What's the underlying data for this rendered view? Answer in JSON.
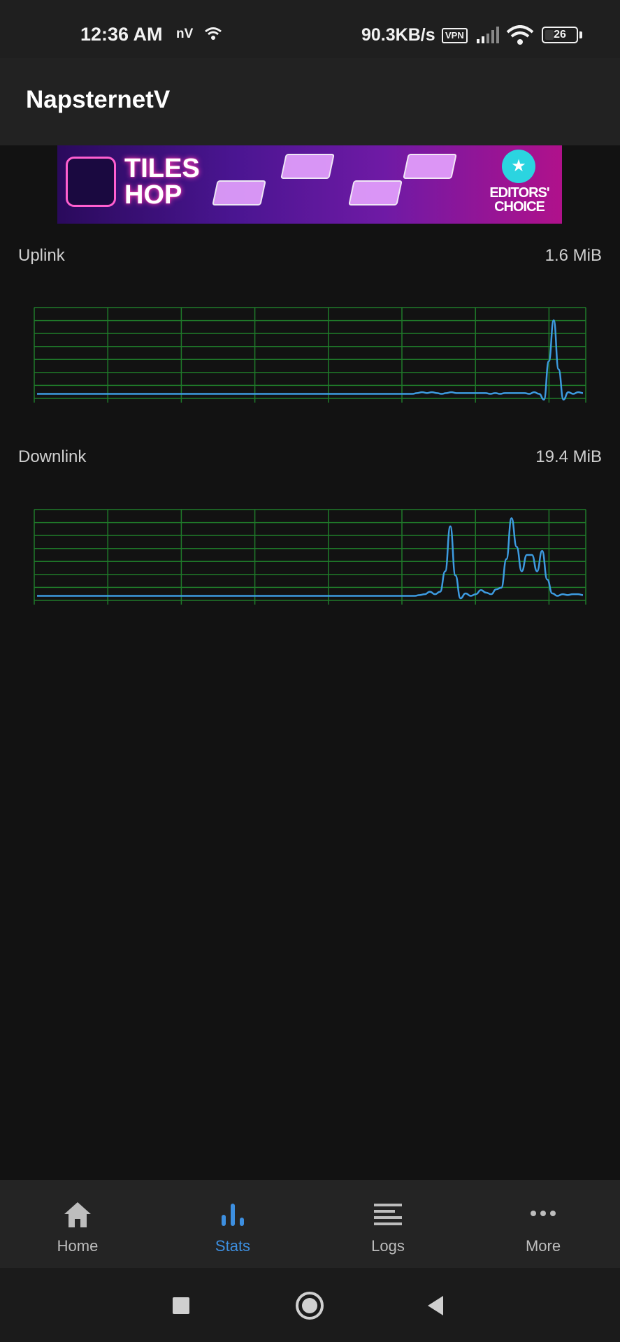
{
  "status_bar": {
    "time": "12:36 AM",
    "carrier_tag": "nV",
    "network_speed": "90.3KB/s",
    "vpn_label": "VPN",
    "battery_level": "26"
  },
  "app_bar": {
    "title": "NapsternetV"
  },
  "ad": {
    "title_line1": "TILES",
    "title_line2": "HOP",
    "badge_line1": "EDITORS'",
    "badge_line2": "CHOICE"
  },
  "uplink": {
    "label": "Uplink",
    "value": "1.6 MiB"
  },
  "downlink": {
    "label": "Downlink",
    "value": "19.4 MiB"
  },
  "chart_data": [
    {
      "type": "line",
      "title": "",
      "grid": true,
      "ylim": [
        0,
        1
      ],
      "series": [
        {
          "values": [
            0,
            0,
            0,
            0,
            0,
            0,
            0,
            0,
            0,
            0,
            0,
            0,
            0,
            0,
            0,
            0,
            0,
            0,
            0,
            0,
            0,
            0,
            0,
            0,
            0,
            0,
            0,
            0,
            0,
            0,
            0,
            0,
            0,
            0,
            0,
            0,
            0,
            0,
            0,
            0,
            0,
            0,
            0,
            0,
            0,
            0,
            0,
            0,
            0,
            0,
            0,
            0,
            0,
            0,
            0,
            0,
            0,
            0,
            0,
            0,
            0,
            0,
            0,
            0,
            0,
            0,
            0,
            0,
            0,
            0,
            0,
            0,
            0,
            0,
            0,
            0,
            0,
            0,
            0.01,
            0.02,
            0.01,
            0.02,
            0.01,
            0,
            0.01,
            0.02,
            0.01,
            0.01,
            0.01,
            0.01,
            0.01,
            0.01,
            0.01,
            0,
            0.01,
            0,
            0.01,
            0.01,
            0.01,
            0.01,
            0.01,
            0,
            0.02,
            0,
            -0.07,
            0.4,
            0.9,
            0.3,
            -0.07,
            0.02,
            0,
            0.02,
            0.01
          ]
        }
      ]
    },
    {
      "type": "line",
      "title": "",
      "grid": true,
      "ylim": [
        0,
        1
      ],
      "series": [
        {
          "values": [
            0,
            0,
            0,
            0,
            0,
            0,
            0,
            0,
            0,
            0,
            0,
            0,
            0,
            0,
            0,
            0,
            0,
            0,
            0,
            0,
            0,
            0,
            0,
            0,
            0,
            0,
            0,
            0,
            0,
            0,
            0,
            0,
            0,
            0,
            0,
            0,
            0,
            0,
            0,
            0,
            0,
            0,
            0,
            0,
            0,
            0,
            0,
            0,
            0,
            0,
            0,
            0,
            0,
            0,
            0,
            0,
            0,
            0,
            0,
            0,
            0,
            0,
            0,
            0,
            0,
            0,
            0,
            0,
            0,
            0,
            0,
            0,
            0,
            0,
            0,
            0.01,
            0.02,
            0.05,
            0.02,
            0.05,
            0.3,
            0.85,
            0.25,
            -0.03,
            0.03,
            0,
            0.02,
            0.07,
            0.04,
            0.02,
            0.08,
            0.1,
            0.45,
            0.95,
            0.6,
            0.3,
            0.5,
            0.5,
            0.3,
            0.55,
            0.2,
            0.03,
            0,
            0.02,
            0.01,
            0.02,
            0.02,
            0.01
          ]
        }
      ]
    }
  ],
  "bottom_nav": {
    "items": [
      {
        "label": "Home",
        "icon": "home-icon"
      },
      {
        "label": "Stats",
        "icon": "bar-chart-icon",
        "active": true
      },
      {
        "label": "Logs",
        "icon": "list-icon"
      },
      {
        "label": "More",
        "icon": "more-dots-icon"
      }
    ]
  },
  "colors": {
    "background": "#121212",
    "accent": "#3d8fe0",
    "chart_line": "#3d9be0",
    "chart_grid": "#1f7a2a"
  }
}
